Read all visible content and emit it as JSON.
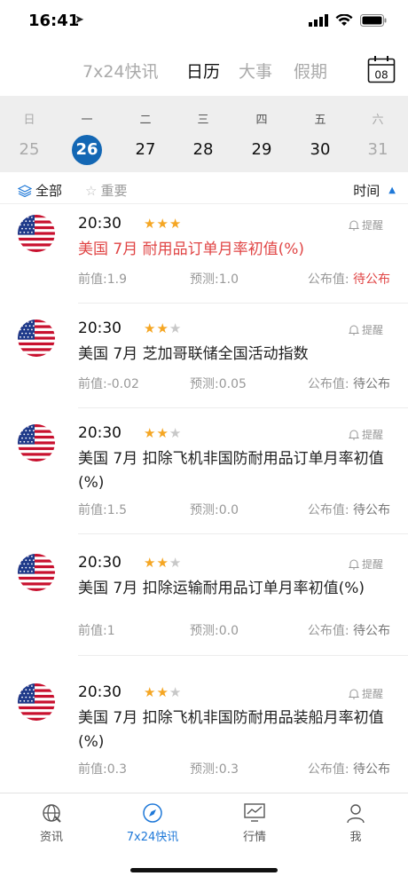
{
  "status": {
    "time": "16:41"
  },
  "topnav": {
    "tabs": [
      "7x24快讯",
      "日历",
      "大事",
      "假期"
    ],
    "active": 1,
    "calendar_day": "08"
  },
  "week": {
    "labels": [
      "日",
      "一",
      "二",
      "三",
      "四",
      "五",
      "六"
    ],
    "days": [
      "25",
      "26",
      "27",
      "28",
      "29",
      "30",
      "31"
    ],
    "selected": 1
  },
  "filter": {
    "all": "全部",
    "important": "重要",
    "sort": "时间"
  },
  "events": [
    {
      "time": "20:30",
      "stars": 3,
      "remind": "提醒",
      "title": "美国 7月 耐用品订单月率初值(%)",
      "highlight": true,
      "prev_label": "前值:",
      "prev": "1.9",
      "forecast_label": "预测:",
      "forecast": "1.0",
      "publish_label": "公布值:",
      "publish": "待公布"
    },
    {
      "time": "20:30",
      "stars": 2,
      "remind": "提醒",
      "title": "美国 7月 芝加哥联储全国活动指数",
      "highlight": false,
      "prev_label": "前值:",
      "prev": "-0.02",
      "forecast_label": "预测:",
      "forecast": "0.05",
      "publish_label": "公布值:",
      "publish": "待公布"
    },
    {
      "time": "20:30",
      "stars": 2,
      "remind": "提醒",
      "title": "美国 7月 扣除飞机非国防耐用品订单月率初值(%)",
      "highlight": false,
      "prev_label": "前值:",
      "prev": "1.5",
      "forecast_label": "预测:",
      "forecast": "0.0",
      "publish_label": "公布值:",
      "publish": "待公布"
    },
    {
      "time": "20:30",
      "stars": 2,
      "remind": "提醒",
      "title": "美国 7月 扣除运输耐用品订单月率初值(%)",
      "highlight": false,
      "prev_label": "前值:",
      "prev": "1",
      "forecast_label": "预测:",
      "forecast": "0.0",
      "publish_label": "公布值:",
      "publish": "待公布"
    },
    {
      "time": "20:30",
      "stars": 2,
      "remind": "提醒",
      "title": "美国 7月 扣除飞机非国防耐用品装船月率初值(%)",
      "highlight": false,
      "prev_label": "前值:",
      "prev": "0.3",
      "forecast_label": "预测:",
      "forecast": "0.3",
      "publish_label": "公布值:",
      "publish": "待公布"
    }
  ],
  "bottom": {
    "tabs": [
      "资讯",
      "7x24快讯",
      "行情",
      "我"
    ],
    "active": 1
  },
  "colors": {
    "accent": "#1367b4",
    "alert": "#e04545",
    "star": "#f5a623"
  }
}
